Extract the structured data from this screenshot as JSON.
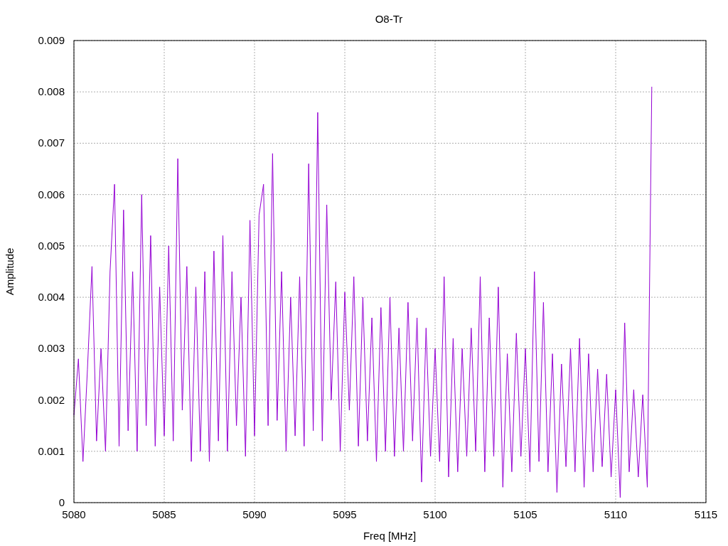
{
  "chart": {
    "chart_data": {
      "type": "line",
      "title": "O8-Tr",
      "xlabel": "Freq [MHz]",
      "ylabel": "Amplitude",
      "xlim": [
        5080,
        5115
      ],
      "ylim": [
        0,
        0.009
      ],
      "grid": true,
      "xticks": [
        5080,
        5085,
        5090,
        5095,
        5100,
        5105,
        5110,
        5115
      ],
      "yticks": [
        0,
        0.001,
        0.002,
        0.003,
        0.004,
        0.005,
        0.006,
        0.007,
        0.008,
        0.009
      ],
      "x": [
        5080,
        5080.25,
        5080.5,
        5080.75,
        5081,
        5081.25,
        5081.5,
        5081.75,
        5082,
        5082.25,
        5082.5,
        5082.75,
        5083,
        5083.25,
        5083.5,
        5083.75,
        5084,
        5084.25,
        5084.5,
        5084.75,
        5085,
        5085.25,
        5085.5,
        5085.75,
        5086,
        5086.25,
        5086.5,
        5086.75,
        5087,
        5087.25,
        5087.5,
        5087.75,
        5088,
        5088.25,
        5088.5,
        5088.75,
        5089,
        5089.25,
        5089.5,
        5089.75,
        5090,
        5090.25,
        5090.5,
        5090.75,
        5091,
        5091.25,
        5091.5,
        5091.75,
        5092,
        5092.25,
        5092.5,
        5092.75,
        5093,
        5093.25,
        5093.5,
        5093.75,
        5094,
        5094.25,
        5094.5,
        5094.75,
        5095,
        5095.25,
        5095.5,
        5095.75,
        5096,
        5096.25,
        5096.5,
        5096.75,
        5097,
        5097.25,
        5097.5,
        5097.75,
        5098,
        5098.25,
        5098.5,
        5098.75,
        5099,
        5099.25,
        5099.5,
        5099.75,
        5100,
        5100.25,
        5100.5,
        5100.75,
        5101,
        5101.25,
        5101.5,
        5101.75,
        5102,
        5102.25,
        5102.5,
        5102.75,
        5103,
        5103.25,
        5103.5,
        5103.75,
        5104,
        5104.25,
        5104.5,
        5104.75,
        5105,
        5105.25,
        5105.5,
        5105.75,
        5106,
        5106.25,
        5106.5,
        5106.75,
        5107,
        5107.25,
        5107.5,
        5107.75,
        5108,
        5108.25,
        5108.5,
        5108.75,
        5109,
        5109.25,
        5109.5,
        5109.75,
        5110,
        5110.25,
        5110.5,
        5110.75,
        5111,
        5111.25,
        5111.5,
        5111.75,
        5112
      ],
      "series": [
        {
          "color": "#9400d3",
          "values": [
            0.0017,
            0.0028,
            0.0008,
            0.0026,
            0.0046,
            0.0012,
            0.003,
            0.001,
            0.0045,
            0.0062,
            0.0011,
            0.0057,
            0.0014,
            0.0045,
            0.001,
            0.006,
            0.0015,
            0.0052,
            0.0011,
            0.0042,
            0.0013,
            0.005,
            0.0012,
            0.0067,
            0.0018,
            0.0046,
            0.0008,
            0.0042,
            0.001,
            0.0045,
            0.0008,
            0.0049,
            0.0012,
            0.0052,
            0.001,
            0.0045,
            0.0015,
            0.004,
            0.0009,
            0.0055,
            0.0013,
            0.0056,
            0.0062,
            0.0015,
            0.0068,
            0.0016,
            0.0045,
            0.001,
            0.004,
            0.0013,
            0.0044,
            0.0011,
            0.0066,
            0.0014,
            0.0076,
            0.0012,
            0.0058,
            0.002,
            0.0043,
            0.001,
            0.0041,
            0.0018,
            0.0044,
            0.0011,
            0.004,
            0.0012,
            0.0036,
            0.0008,
            0.0038,
            0.001,
            0.004,
            0.0009,
            0.0034,
            0.001,
            0.0039,
            0.0012,
            0.0036,
            0.0004,
            0.0034,
            0.0009,
            0.003,
            0.0008,
            0.0044,
            0.0005,
            0.0032,
            0.0006,
            0.003,
            0.0009,
            0.0034,
            0.001,
            0.0044,
            0.0006,
            0.0036,
            0.0009,
            0.0042,
            0.0003,
            0.0029,
            0.0006,
            0.0033,
            0.0009,
            0.003,
            0.0006,
            0.0045,
            0.0008,
            0.0039,
            0.0006,
            0.0029,
            0.0002,
            0.0027,
            0.0007,
            0.003,
            0.0006,
            0.0032,
            0.0003,
            0.0029,
            0.0006,
            0.0026,
            0.0007,
            0.0025,
            0.0005,
            0.0022,
            0.0001,
            0.0035,
            0.0006,
            0.0022,
            0.0005,
            0.0021,
            0.0003,
            0.0081
          ]
        }
      ]
    }
  }
}
